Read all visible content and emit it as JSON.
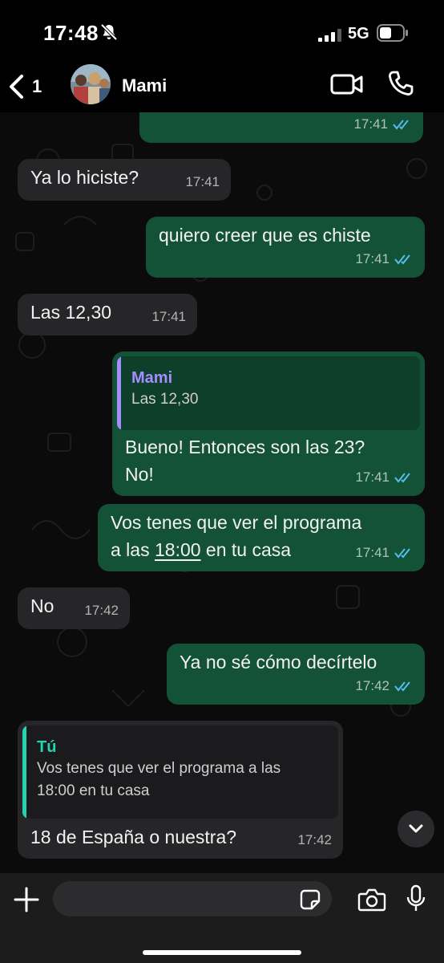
{
  "status_bar": {
    "time": "17:48",
    "network": "5G"
  },
  "header": {
    "back_count": "1",
    "contact_name": "Mami"
  },
  "messages": [
    {
      "direction": "out",
      "text": "",
      "time": "17:41",
      "read": true
    },
    {
      "direction": "in",
      "text": "Ya lo hiciste?",
      "time": "17:41"
    },
    {
      "direction": "out",
      "text": "quiero creer que es chiste",
      "time": "17:41",
      "read": true
    },
    {
      "direction": "in",
      "text": "Las 12,30",
      "time": "17:41"
    },
    {
      "direction": "out",
      "quote_name": "Mami",
      "quote_text": "Las 12,30",
      "text_line1": "Bueno! Entonces son las 23?",
      "text_line2": "No!",
      "time": "17:41",
      "read": true
    },
    {
      "direction": "out",
      "text_line1": "Vos tenes que ver el programa",
      "text_line2_pre": "a las ",
      "text_line2_link": "18:00",
      "text_line2_post": " en tu casa",
      "time": "17:41",
      "read": true
    },
    {
      "direction": "in",
      "text": "No",
      "time": "17:42"
    },
    {
      "direction": "out",
      "text": "Ya no sé cómo decírtelo",
      "time": "17:42",
      "read": true
    },
    {
      "direction": "in",
      "quote_name": "Tú",
      "quote_line1": "Vos tenes que ver el programa a las",
      "quote_line2": "18:00 en tu casa",
      "text": "18 de España o nuestra?",
      "time": "17:42"
    }
  ],
  "colors": {
    "outgoing_bubble": "#135237",
    "incoming_bubble": "#262628",
    "read_ticks": "#53bdeb",
    "quote_bar_mami": "#a58cff",
    "quote_bar_tu": "#25d3b0"
  },
  "input": {
    "placeholder": ""
  }
}
